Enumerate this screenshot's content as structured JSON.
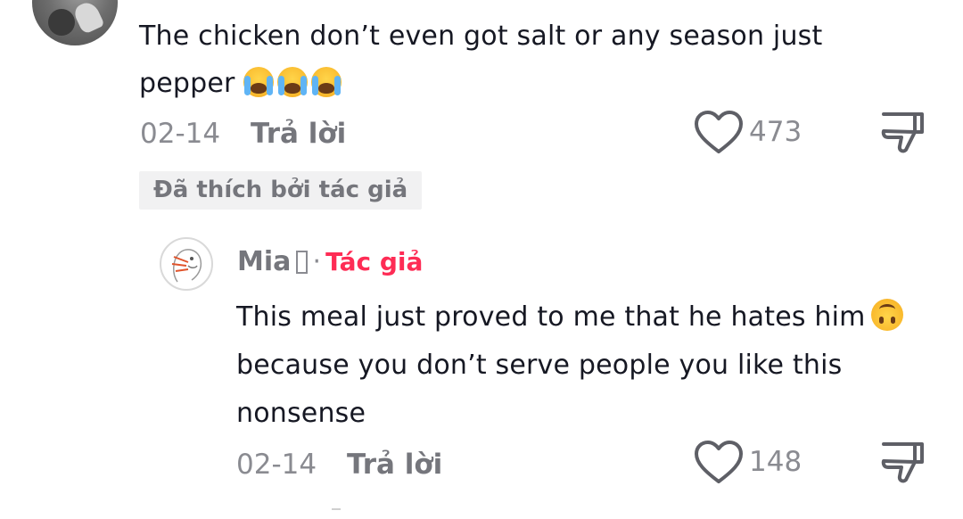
{
  "top_comment": {
    "text_line1": "The chicken don’t even got salt or any season just",
    "text_line2": "pepper",
    "emoji": "loudly-crying-face",
    "emoji_count": 3,
    "date": "02-14",
    "reply_label": "Trả lời",
    "like_count": "473",
    "liked_by_author_label": "Đã thích bởi tác giả"
  },
  "reply_comment": {
    "username": "Mia",
    "author_label": "Tác giả",
    "separator": "·",
    "text_line1": "This meal just proved to me that he hates him",
    "text_line2": "because you don’t serve people you like this",
    "text_line3": "nonsense",
    "emoji": "upside-down-face",
    "date": "02-14",
    "reply_label": "Trả lời",
    "like_count": "148"
  },
  "colors": {
    "text_primary": "#161823",
    "text_secondary": "#8a8b91",
    "author_accent": "#fe2c55",
    "badge_bg": "#f1f1f2"
  },
  "icons": {
    "like": "heart-outline-icon",
    "dislike": "thumbs-down-icon"
  }
}
